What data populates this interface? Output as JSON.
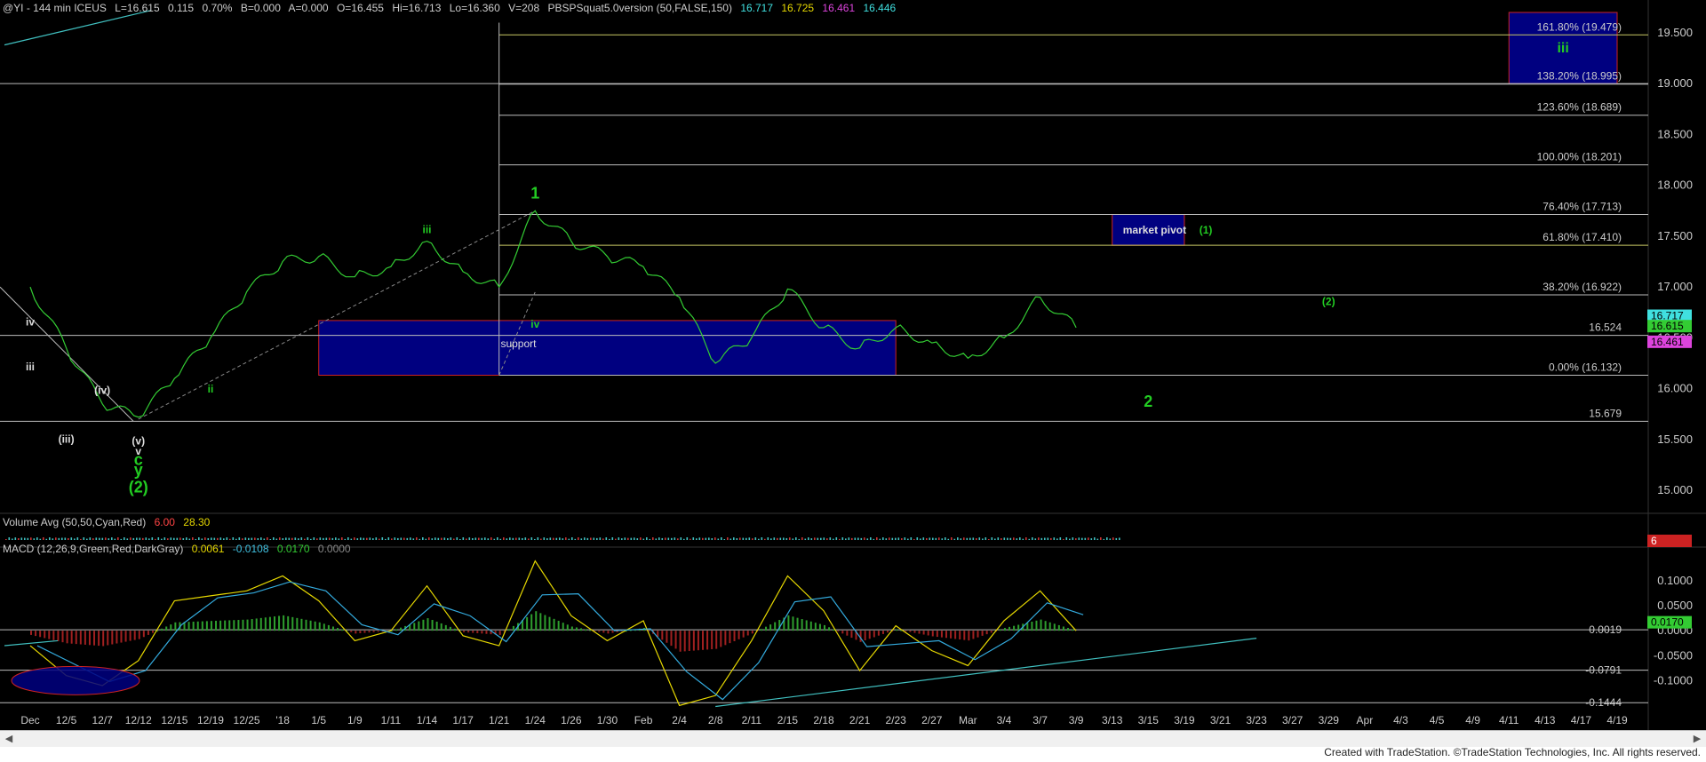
{
  "header": {
    "symbol": "@YI - 144 min  ICEUS",
    "last": "L=16.615",
    "chg": "0.115",
    "pct": "0.70%",
    "bid": "B=0.000",
    "ask": "A=0.000",
    "open": "O=16.455",
    "hi": "Hi=16.713",
    "lo": "Lo=16.360",
    "vol": "V=208",
    "study": "PBSPSquat5.0version (50,FALSE,150)",
    "v1": "16.717",
    "v2": "16.725",
    "v3": "16.461",
    "v4": "16.446"
  },
  "volume_header": {
    "label": "Volume Avg (50,50,Cyan,Red)",
    "v1": "6.00",
    "v2": "28.30"
  },
  "macd_header": {
    "label": "MACD (12,26,9,Green,Red,DarkGray)",
    "v1": "0.0061",
    "v2": "-0.0108",
    "v3": "0.0170",
    "v4": "0.0000"
  },
  "credit": "Created with TradeStation. ©TradeStation Technologies, Inc. All rights reserved.",
  "colors": {
    "bg": "#000000",
    "price": "#33cc33",
    "fib": "#ffffff",
    "fib_gold": "#c8c864",
    "box_fill": "#000080",
    "box_border": "#cc2222",
    "wave_green": "#22cc22",
    "wave_white": "#dddddd",
    "trend": "#40c0c0",
    "macd_line": "#33aadd",
    "signal_line": "#e6d800",
    "hist_pos": "#2e9e2e",
    "hist_neg": "#a02020"
  },
  "chart_data": [
    {
      "type": "line",
      "title": "@YI - 144 min",
      "y_axis_ticks": [
        "19.500",
        "19.000",
        "18.500",
        "18.000",
        "17.500",
        "17.000",
        "16.500",
        "16.000",
        "15.500",
        "15.000"
      ],
      "ylim": [
        14.8,
        19.7
      ],
      "x_tick_labels": [
        "Dec",
        "12/5",
        "12/7",
        "12/12",
        "12/15",
        "12/19",
        "12/25",
        "'18",
        "1/5",
        "1/9",
        "1/11",
        "1/14",
        "1/17",
        "1/21",
        "1/24",
        "1/26",
        "1/30",
        "Feb",
        "2/4",
        "2/8",
        "2/11",
        "2/15",
        "2/18",
        "2/21",
        "2/23",
        "2/27",
        "Mar",
        "3/4",
        "3/7",
        "3/9",
        "3/13",
        "3/15",
        "3/19",
        "3/21",
        "3/23",
        "3/27",
        "3/29",
        "Apr",
        "4/3",
        "4/5",
        "4/9",
        "4/11",
        "4/13",
        "4/17",
        "4/19"
      ],
      "price_series": [
        {
          "x": "Dec",
          "y": 17.0
        },
        {
          "x": "12/5",
          "y": 16.4
        },
        {
          "x": "12/7",
          "y": 15.85
        },
        {
          "x": "12/12",
          "y": 15.72
        },
        {
          "x": "12/15",
          "y": 16.1
        },
        {
          "x": "12/19",
          "y": 16.5
        },
        {
          "x": "12/25",
          "y": 16.95
        },
        {
          "x": "'18",
          "y": 17.25
        },
        {
          "x": "1/5",
          "y": 17.3
        },
        {
          "x": "1/9",
          "y": 17.1
        },
        {
          "x": "1/11",
          "y": 17.2
        },
        {
          "x": "1/14",
          "y": 17.45
        },
        {
          "x": "1/17",
          "y": 17.15
        },
        {
          "x": "1/21",
          "y": 17.0
        },
        {
          "x": "1/24",
          "y": 17.75
        },
        {
          "x": "1/26",
          "y": 17.45
        },
        {
          "x": "1/30",
          "y": 17.3
        },
        {
          "x": "Feb",
          "y": 17.2
        },
        {
          "x": "2/4",
          "y": 16.9
        },
        {
          "x": "2/8",
          "y": 16.25
        },
        {
          "x": "2/11",
          "y": 16.5
        },
        {
          "x": "2/15",
          "y": 16.98
        },
        {
          "x": "2/18",
          "y": 16.6
        },
        {
          "x": "2/21",
          "y": 16.4
        },
        {
          "x": "2/23",
          "y": 16.6
        },
        {
          "x": "2/27",
          "y": 16.45
        },
        {
          "x": "Mar",
          "y": 16.3
        },
        {
          "x": "3/4",
          "y": 16.5
        },
        {
          "x": "3/7",
          "y": 16.9
        },
        {
          "x": "3/9",
          "y": 16.6
        }
      ],
      "fib_levels": [
        {
          "label": "161.80% (19.479)",
          "value": 19.479
        },
        {
          "label": "138.20% (18.995)",
          "value": 18.995
        },
        {
          "label": "123.60% (18.689)",
          "value": 18.689
        },
        {
          "label": "100.00% (18.201)",
          "value": 18.201
        },
        {
          "label": "76.40% (17.713)",
          "value": 17.713
        },
        {
          "label": "61.80% (17.410)",
          "value": 17.41
        },
        {
          "label": "38.20% (16.922)",
          "value": 16.922
        },
        {
          "label": "0.00% (16.132)",
          "value": 16.132
        }
      ],
      "horizontal_levels": [
        {
          "label": "16.524",
          "value": 16.524
        },
        {
          "label": "15.679",
          "value": 15.679
        },
        {
          "label": "",
          "value": 19.0
        }
      ],
      "price_tags": [
        {
          "label": "16.717",
          "value": 16.717,
          "color": "#40e0e0"
        },
        {
          "label": "16.615",
          "value": 16.615,
          "color": "#33cc33"
        },
        {
          "label": "16.461",
          "value": 16.461,
          "color": "#dd44dd"
        }
      ],
      "boxes": [
        {
          "label": "support",
          "from": "1/5",
          "to": "2/23",
          "y1": 16.132,
          "y2": 16.67
        },
        {
          "label": "market pivot",
          "sub": "(1)",
          "from": "3/13",
          "to": "3/19",
          "y1": 17.41,
          "y2": 17.713
        },
        {
          "label": "iii",
          "from": "4/11",
          "to": "4/19",
          "y1": 19.0,
          "y2": 19.7
        }
      ],
      "wave_labels": [
        {
          "text": "iv",
          "x": "Dec",
          "y": 16.62,
          "color": "#dddddd"
        },
        {
          "text": "iii",
          "x": "Dec",
          "y": 16.18,
          "color": "#dddddd"
        },
        {
          "text": "(iv)",
          "x": "12/7",
          "y": 15.95,
          "color": "#dddddd"
        },
        {
          "text": "(iii)",
          "x": "12/5",
          "y": 15.47,
          "color": "#dddddd"
        },
        {
          "text": "(v)",
          "x": "12/12",
          "y": 15.45,
          "color": "#dddddd"
        },
        {
          "text": "v",
          "x": "12/12",
          "y": 15.35,
          "color": "#dddddd"
        },
        {
          "text": "c",
          "x": "12/12",
          "y": 15.25,
          "color": "#22cc22"
        },
        {
          "text": "y",
          "x": "12/12",
          "y": 15.15,
          "color": "#22cc22"
        },
        {
          "text": "(2)",
          "x": "12/12",
          "y": 14.98,
          "color": "#22cc22"
        },
        {
          "text": "ii",
          "x": "12/19",
          "y": 15.96,
          "color": "#22cc22"
        },
        {
          "text": "iii",
          "x": "1/14",
          "y": 17.53,
          "color": "#22cc22"
        },
        {
          "text": "1",
          "x": "1/24",
          "y": 17.87,
          "color": "#22cc22"
        },
        {
          "text": "iv",
          "x": "1/24",
          "y": 16.6,
          "color": "#22cc22"
        },
        {
          "text": "(2)",
          "x": "3/29",
          "y": 16.82,
          "color": "#22cc22"
        },
        {
          "text": "2",
          "x": "3/15",
          "y": 15.82,
          "color": "#22cc22"
        }
      ]
    },
    {
      "type": "bar",
      "title": "Volume Avg (50,50,Cyan,Red)",
      "tag": "6"
    },
    {
      "type": "line",
      "title": "MACD (12,26,9,Green,Red,DarkGray)",
      "y_axis_ticks": [
        "0.1000",
        "0.0500",
        "0.0000",
        "-0.0500",
        "-0.1000"
      ],
      "ylim": [
        -0.16,
        0.15
      ],
      "levels": [
        {
          "label": "0.0019",
          "value": 0.0019
        },
        {
          "label": "-0.0791",
          "value": -0.0791
        },
        {
          "label": "-0.1444",
          "value": -0.1444
        }
      ],
      "tags": [
        {
          "label": "0.0170",
          "value": 0.017,
          "color": "#33cc33"
        }
      ],
      "macd_series": [
        {
          "x": "Dec",
          "y": -0.03
        },
        {
          "x": "12/5",
          "y": -0.09
        },
        {
          "x": "12/7",
          "y": -0.11
        },
        {
          "x": "12/12",
          "y": -0.06
        },
        {
          "x": "12/15",
          "y": 0.06
        },
        {
          "x": "12/19",
          "y": 0.07
        },
        {
          "x": "12/25",
          "y": 0.08
        },
        {
          "x": "'18",
          "y": 0.11
        },
        {
          "x": "1/5",
          "y": 0.06
        },
        {
          "x": "1/9",
          "y": -0.02
        },
        {
          "x": "1/11",
          "y": 0.0
        },
        {
          "x": "1/14",
          "y": 0.09
        },
        {
          "x": "1/17",
          "y": -0.01
        },
        {
          "x": "1/21",
          "y": -0.03
        },
        {
          "x": "1/24",
          "y": 0.14
        },
        {
          "x": "1/26",
          "y": 0.03
        },
        {
          "x": "1/30",
          "y": -0.02
        },
        {
          "x": "Feb",
          "y": 0.02
        },
        {
          "x": "2/4",
          "y": -0.15
        },
        {
          "x": "2/8",
          "y": -0.13
        },
        {
          "x": "2/11",
          "y": -0.02
        },
        {
          "x": "2/15",
          "y": 0.11
        },
        {
          "x": "2/18",
          "y": 0.04
        },
        {
          "x": "2/21",
          "y": -0.08
        },
        {
          "x": "2/23",
          "y": 0.01
        },
        {
          "x": "2/27",
          "y": -0.04
        },
        {
          "x": "Mar",
          "y": -0.07
        },
        {
          "x": "3/4",
          "y": 0.02
        },
        {
          "x": "3/7",
          "y": 0.08
        },
        {
          "x": "3/9",
          "y": 0.0
        }
      ]
    }
  ]
}
